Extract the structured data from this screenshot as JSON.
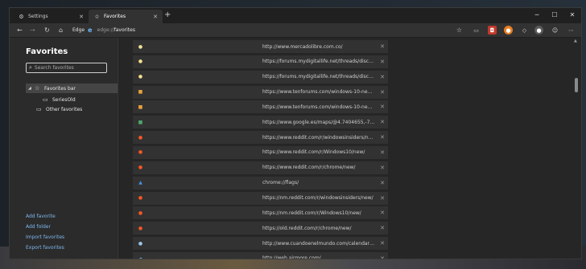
{
  "tabs": [
    {
      "label": "Settings",
      "icon": "gear-icon",
      "active": false
    },
    {
      "label": "Favorites",
      "icon": "star-icon",
      "active": true
    }
  ],
  "toolbar": {
    "edge_label": "Edge",
    "url_prefix": "edge://",
    "url_path": "favorites"
  },
  "sidebar": {
    "title": "Favorites",
    "search_placeholder": "Search favorites",
    "tree": [
      {
        "label": "Favorites bar"
      },
      {
        "label": "SeriesOld"
      },
      {
        "label": "Other favorites"
      }
    ],
    "links": {
      "add_favorite": "Add favorite",
      "add_folder": "Add folder",
      "import_favorites": "Import favorites",
      "export_favorites": "Export favorites"
    }
  },
  "favorites": [
    {
      "url": "http://www.mercadolibre.com.co/",
      "icon": "yellow-site-icon",
      "color": "#f5e39a"
    },
    {
      "url": "https://forums.mydigitallife.net/threads/discussion",
      "icon": "yellow-bulb-icon",
      "color": "#f6df8e"
    },
    {
      "url": "https://forums.mydigitallife.net/threads/discussion",
      "icon": "yellow-bulb-icon",
      "color": "#f6df8e"
    },
    {
      "url": "https://www.tenforums.com/windows-10-news/1",
      "icon": "windows-icon",
      "color": "#e9a23b"
    },
    {
      "url": "https://www.tenforums.com/windows-10-news/1",
      "icon": "windows-icon",
      "color": "#e9a23b"
    },
    {
      "url": "https://www.google.es/maps/@4.7404655,-74.17",
      "icon": "maps-icon",
      "color": "#4ea86b"
    },
    {
      "url": "https://www.reddit.com/r/windowsinsiders/new/",
      "icon": "reddit-icon",
      "color": "#ff5722"
    },
    {
      "url": "https://www.reddit.com/r/Windows10/new/",
      "icon": "reddit-icon",
      "color": "#ff5722"
    },
    {
      "url": "https://www.reddit.com/r/chrome/new/",
      "icon": "reddit-icon",
      "color": "#ff5722"
    },
    {
      "url": "chrome://flags/",
      "icon": "flask-icon",
      "color": "#4a90e2"
    },
    {
      "url": "https://nm.reddit.com/r/windowsinsiders/new/",
      "icon": "reddit-icon",
      "color": "#ff5722"
    },
    {
      "url": "https://nm.reddit.com/r/Windows10/new/",
      "icon": "reddit-icon",
      "color": "#ff5722"
    },
    {
      "url": "https://old.reddit.com/r/chrome/new/",
      "icon": "reddit-icon",
      "color": "#ff5722"
    },
    {
      "url": "http://www.cuandoenelmundo.com/calendario/c",
      "icon": "globe-icon",
      "color": "#9ec7e8"
    },
    {
      "url": "http://web.airmore.com/",
      "icon": "cloud-icon",
      "color": "#5fb0e0"
    }
  ]
}
